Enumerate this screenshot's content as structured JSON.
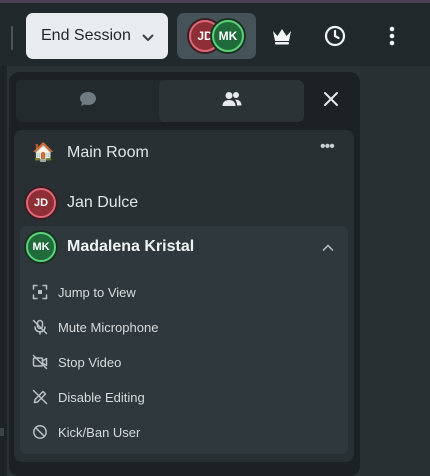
{
  "toolbar": {
    "end_session_label": "End Session",
    "participants": [
      {
        "initials": "JD",
        "color": "#8e2f36"
      },
      {
        "initials": "MK",
        "color": "#1f6b3a"
      }
    ],
    "icons": [
      "chevron-down-icon",
      "crown-icon",
      "clock-icon",
      "vertical-ellipsis-icon"
    ]
  },
  "panel": {
    "tabs": [
      {
        "name": "chat",
        "icon": "chat-bubble-icon",
        "active": false
      },
      {
        "name": "people",
        "icon": "people-icon",
        "active": true
      }
    ],
    "room": {
      "icon": "🏠",
      "name": "Main Room",
      "more_label": "•••"
    },
    "users": [
      {
        "initials": "JD",
        "name": "Jan Dulce",
        "color": "#8e2f36",
        "ring": "#e0667a",
        "expanded": false
      },
      {
        "initials": "MK",
        "name": "Madalena Kristal",
        "color": "#1f6b3a",
        "ring": "#5fd07e",
        "expanded": true
      }
    ],
    "actions": [
      {
        "label": "Jump to View",
        "icon": "focus-frame-icon"
      },
      {
        "label": "Mute Microphone",
        "icon": "microphone-off-icon"
      },
      {
        "label": "Stop Video",
        "icon": "video-off-icon"
      },
      {
        "label": "Disable Editing",
        "icon": "pencil-off-icon"
      },
      {
        "label": "Kick/Ban User",
        "icon": "ban-icon"
      }
    ]
  },
  "colors": {
    "panel_bg": "#1b2124",
    "list_bg": "#283034",
    "selected_bg": "#2f383c",
    "end_button_bg": "#e9ecee",
    "text": "#e2e6e8"
  }
}
